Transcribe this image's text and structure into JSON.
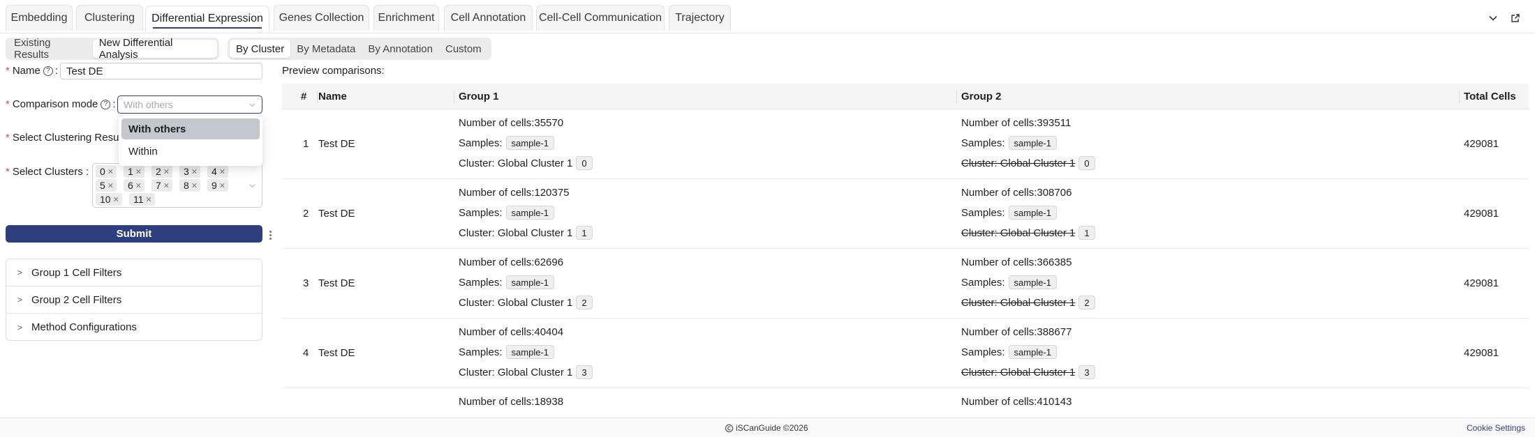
{
  "tabs": [
    {
      "label": "Embedding"
    },
    {
      "label": "Clustering"
    },
    {
      "label": "Differential Expression",
      "active": true
    },
    {
      "label": "Genes Collection"
    },
    {
      "label": "Enrichment"
    },
    {
      "label": "Cell Annotation"
    },
    {
      "label": "Cell-Cell Communication"
    },
    {
      "label": "Trajectory"
    }
  ],
  "mode_tabs": [
    "Existing Results",
    "New Differential Analysis"
  ],
  "mode_active": "New Differential Analysis",
  "group_tabs": [
    "By Cluster",
    "By Metadata",
    "By Annotation",
    "Custom"
  ],
  "group_active": "By Cluster",
  "form": {
    "name_label": "Name",
    "name_value": "Test DE",
    "comparison_label": "Comparison mode",
    "comparison_placeholder": "With others",
    "comparison_options": [
      "With others",
      "Within"
    ],
    "clustering_label": "Select Clustering Resul",
    "clusters_label": "Select Clusters",
    "clusters": [
      "0",
      "1",
      "2",
      "3",
      "4",
      "5",
      "6",
      "7",
      "8",
      "9",
      "10",
      "11"
    ],
    "submit_label": "Submit"
  },
  "collapse": [
    "Group 1 Cell Filters",
    "Group 2 Cell Filters",
    "Method Configurations"
  ],
  "preview": {
    "title": "Preview comparisons:",
    "columns": [
      "#",
      "Name",
      "Group 1",
      "Group 2",
      "Total Cells"
    ],
    "labels": {
      "cells": "Number of cells: ",
      "samples": "Samples:",
      "cluster": "Cluster: Global Cluster 1"
    },
    "rows": [
      {
        "index": "1",
        "name": "Test DE",
        "g1_cells": "35570",
        "g1_sample": "sample-1",
        "g1_cluster": "0",
        "g2_cells": "393511",
        "g2_sample": "sample-1",
        "g2_cluster": "0",
        "total": "429081"
      },
      {
        "index": "2",
        "name": "Test DE",
        "g1_cells": "120375",
        "g1_sample": "sample-1",
        "g1_cluster": "1",
        "g2_cells": "308706",
        "g2_sample": "sample-1",
        "g2_cluster": "1",
        "total": "429081"
      },
      {
        "index": "3",
        "name": "Test DE",
        "g1_cells": "62696",
        "g1_sample": "sample-1",
        "g1_cluster": "2",
        "g2_cells": "366385",
        "g2_sample": "sample-1",
        "g2_cluster": "2",
        "total": "429081"
      },
      {
        "index": "4",
        "name": "Test DE",
        "g1_cells": "40404",
        "g1_sample": "sample-1",
        "g1_cluster": "3",
        "g2_cells": "388677",
        "g2_sample": "sample-1",
        "g2_cluster": "3",
        "total": "429081"
      },
      {
        "index": "",
        "name": "",
        "g1_cells": "18938",
        "g2_cells": "410143",
        "total": ""
      }
    ]
  },
  "footer": {
    "brand": "iSCanGuide ©2026",
    "cookie": "Cookie Settings"
  },
  "colors": {
    "primary": "#2e3f80",
    "required": "#e5484d"
  }
}
